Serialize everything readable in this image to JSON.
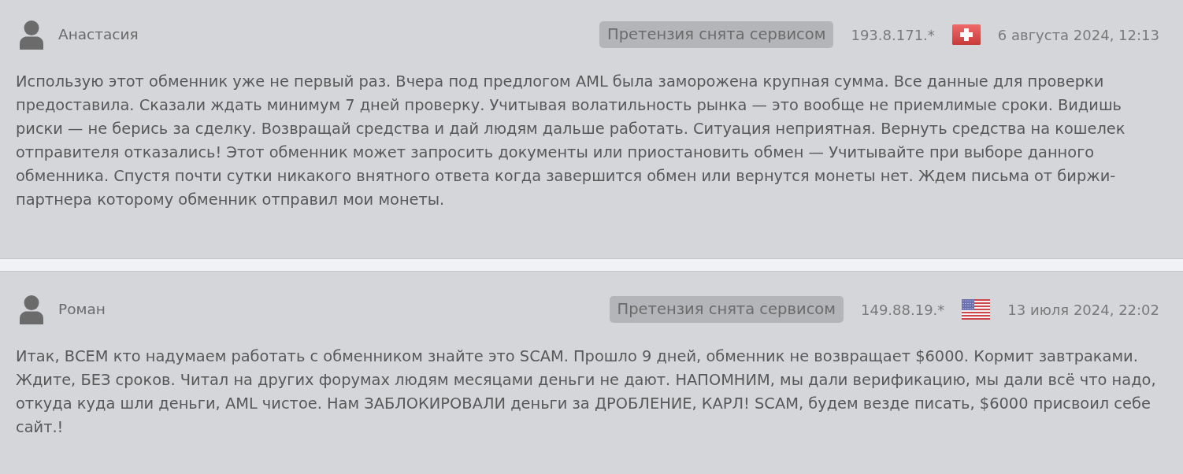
{
  "reviews": [
    {
      "author": "Анастасия",
      "status": "Претензия снята сервисом",
      "ip": "193.8.171.*",
      "flag": {
        "kind": "switzerland"
      },
      "date": "6 августа 2024, 12:13",
      "text": "Использую этот обменник уже не первый раз. Вчера под предлогом AML была заморожена крупная сумма. Все данные для проверки предоставила. Сказали ждать минимум 7 дней проверку. Учитывая волатильность рынка — это вообще не приемлимые сроки. Видишь риски — не берись за сделку. Возвращай средства и дай людям дальше работать. Ситуация неприятная. Вернуть средства на кошелек отправителя отказались! Этот обменник может запросить документы или приостановить обмен — Учитывайте при выборе данного обменника. Спустя почти сутки никакого внятного ответа когда завершится обмен или вернутся монеты нет. Ждем письма от биржи-партнера которому обменник отправил мои монеты."
    },
    {
      "author": "Роман",
      "status": "Претензия снята сервисом",
      "ip": "149.88.19.*",
      "flag": {
        "kind": "usa"
      },
      "date": "13 июля 2024, 22:02",
      "text": "Итак, ВСЕМ кто надумаем работать с обменником знайте это SCAM. Прошло 9 дней, обменник не возвращает $6000. Кормит завтраками. Ждите, БЕЗ сроков. Читал на других форумах людям месяцами деньги не дают. НАПОМНИМ, мы дали верификацию, мы дали всё что надо, откуда куда шли деньги, AML чистое. Нам ЗАБЛОКИРОВАЛИ деньги за ДРОБЛЕНИЕ, КАРЛ! SCAM, будем везде писать, $6000 присвоил себе сайт.!"
    }
  ]
}
